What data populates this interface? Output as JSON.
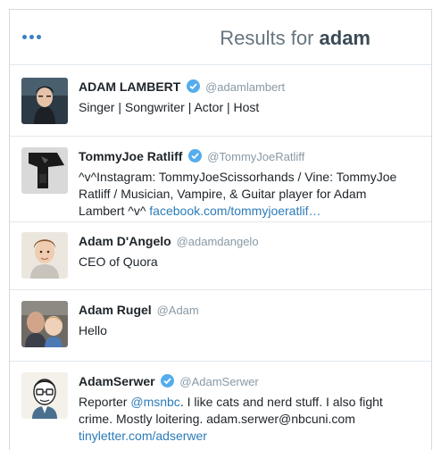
{
  "header": {
    "more_icon": "ellipsis-icon",
    "title_prefix": "Results for ",
    "query": "adam"
  },
  "colors": {
    "accent": "#3a7fc1",
    "link": "#2b7bb9",
    "verified": "#55acee",
    "handle": "#8899a6"
  },
  "results": [
    {
      "name": "ADAM LAMBERT",
      "verified": true,
      "handle": "@adamlambert",
      "bio": "Singer | Songwriter | Actor | Host"
    },
    {
      "name": "TommyJoe Ratliff",
      "verified": true,
      "handle": "@TommyJoeRatliff",
      "bio": "^v^Instagram: TommyJoeScissorhands / Vine: TommyJoe Ratliff / Musician, Vampire, & Guitar player for Adam Lambert ^v^ ",
      "link": "facebook.com/tommyjoeratlif…"
    },
    {
      "name": "Adam D'Angelo",
      "verified": false,
      "handle": "@adamdangelo",
      "bio": "CEO of Quora"
    },
    {
      "name": "Adam Rugel",
      "verified": false,
      "handle": "@Adam",
      "bio": "Hello"
    },
    {
      "name": "AdamSerwer",
      "verified": true,
      "handle": "@AdamSerwer",
      "bio_before": "Reporter ",
      "mention": "@msnbc",
      "bio_after": ". I like cats and nerd stuff. I also fight crime. Mostly loitering. adam.serwer@nbcuni.com ",
      "link": "tinyletter.com/adserwer"
    }
  ]
}
